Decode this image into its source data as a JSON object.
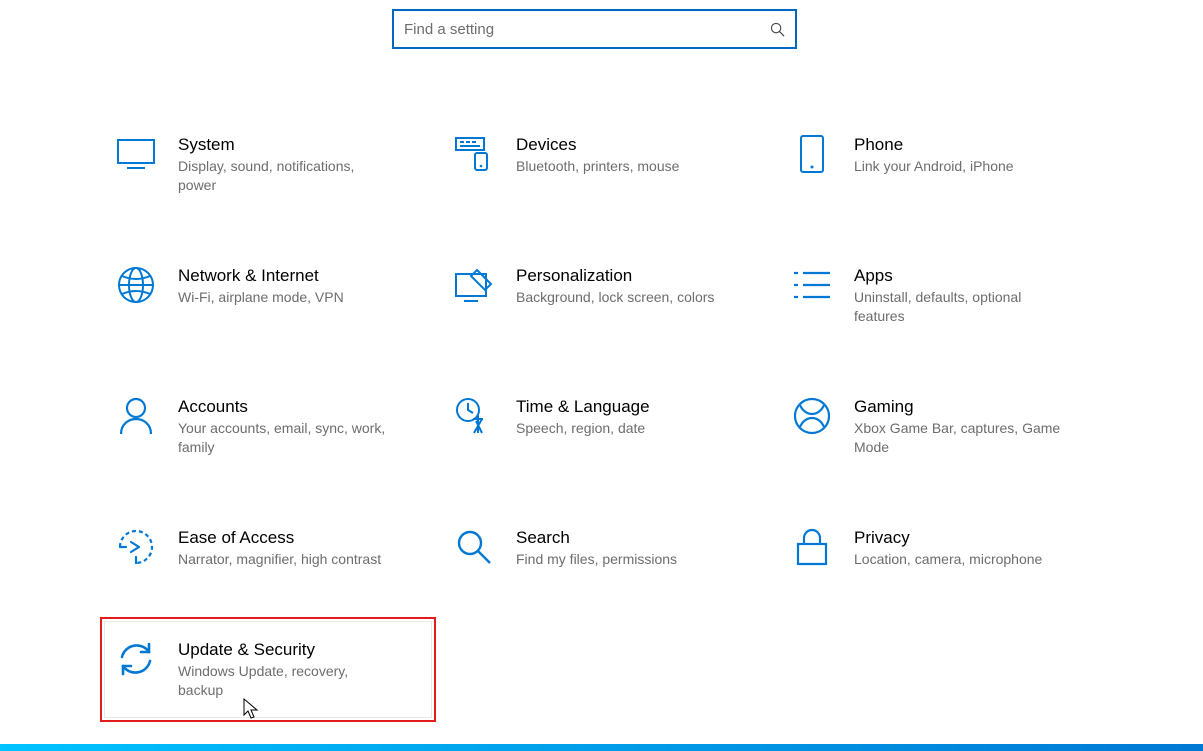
{
  "search": {
    "placeholder": "Find a setting"
  },
  "tiles": {
    "system": {
      "title": "System",
      "desc": "Display, sound, notifications, power"
    },
    "devices": {
      "title": "Devices",
      "desc": "Bluetooth, printers, mouse"
    },
    "phone": {
      "title": "Phone",
      "desc": "Link your Android, iPhone"
    },
    "network": {
      "title": "Network & Internet",
      "desc": "Wi-Fi, airplane mode, VPN"
    },
    "personalization": {
      "title": "Personalization",
      "desc": "Background, lock screen, colors"
    },
    "apps": {
      "title": "Apps",
      "desc": "Uninstall, defaults, optional features"
    },
    "accounts": {
      "title": "Accounts",
      "desc": "Your accounts, email, sync, work, family"
    },
    "time": {
      "title": "Time & Language",
      "desc": "Speech, region, date"
    },
    "gaming": {
      "title": "Gaming",
      "desc": "Xbox Game Bar, captures, Game Mode"
    },
    "ease": {
      "title": "Ease of Access",
      "desc": "Narrator, magnifier, high contrast"
    },
    "search": {
      "title": "Search",
      "desc": "Find my files, permissions"
    },
    "privacy": {
      "title": "Privacy",
      "desc": "Location, camera, microphone"
    },
    "update": {
      "title": "Update & Security",
      "desc": "Windows Update, recovery, backup"
    }
  },
  "accent": "#0078d4"
}
